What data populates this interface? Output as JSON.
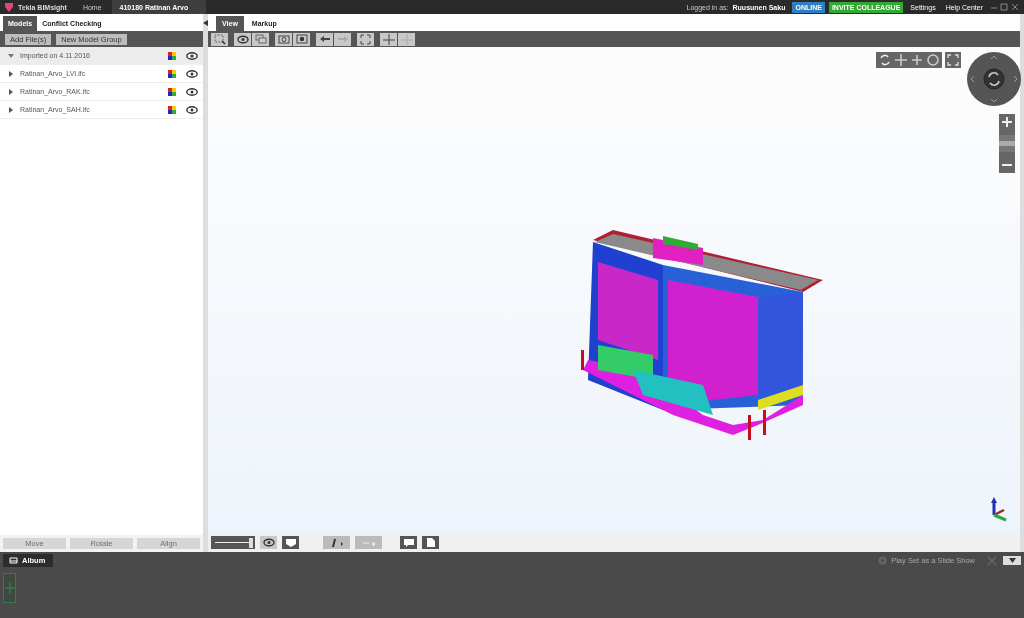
{
  "app": {
    "title": "Tekla BIMsight",
    "nav": [
      {
        "label": "Home",
        "selected": false
      },
      {
        "label": "410180 Ratinan Arvo",
        "selected": true
      }
    ],
    "user_label": "Logged in as:",
    "user": "Ruusunen Saku",
    "status": "ONLINE",
    "invite": "INVITE COLLEAGUE",
    "links": [
      "Settings",
      "Help Center"
    ]
  },
  "left_tabs": [
    {
      "label": "Models",
      "selected": true
    },
    {
      "label": "Conflict Checking",
      "selected": false
    }
  ],
  "left_buttons": [
    "Add File(s)",
    "New Model Group"
  ],
  "tree": [
    {
      "label": "Imported on 4.11.2016",
      "expanded": true,
      "children": [
        {
          "label": "Ratinan_Arvo_LVI.ifc",
          "expanded": false
        },
        {
          "label": "Ratinan_Arvo_RAK.ifc",
          "expanded": false
        },
        {
          "label": "Ratinan_Arvo_SAH.ifc",
          "expanded": false
        }
      ]
    }
  ],
  "transform_buttons": [
    {
      "label": "Move",
      "disabled": true
    },
    {
      "label": "Rotate",
      "disabled": true
    },
    {
      "label": "Align",
      "disabled": true
    }
  ],
  "view_tabs": [
    {
      "label": "View",
      "selected": true
    },
    {
      "label": "Markup",
      "selected": false
    }
  ],
  "slider": {
    "level": 0.95
  },
  "zoom": {
    "level": 0.5
  },
  "album": {
    "label": "Album"
  },
  "slideshow": {
    "label": "Play Set as a Slide Show",
    "disabled": true
  }
}
